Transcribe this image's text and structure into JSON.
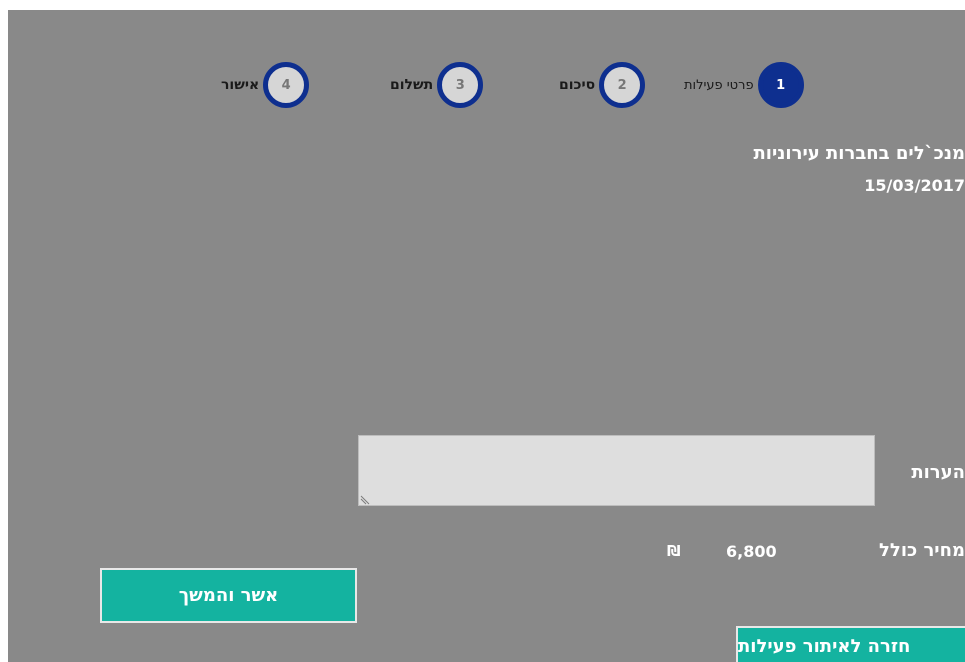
{
  "steps": [
    {
      "number": "1",
      "label": "פרטי פעילות",
      "active": true
    },
    {
      "number": "2",
      "label": "סיכום",
      "active": false
    },
    {
      "number": "3",
      "label": "תשלום",
      "active": false
    },
    {
      "number": "4",
      "label": "אישור",
      "active": false
    }
  ],
  "activity": {
    "title": "מנכ`לים בחברות עירוניות",
    "date": "15/03/2017"
  },
  "notes": {
    "label": "הערות",
    "value": ""
  },
  "price": {
    "label": "מחיר כולל",
    "value": "6,800",
    "currency": "₪"
  },
  "buttons": {
    "confirm_label": "אשר והמשך",
    "back_label": "חזרה לאיתור פעילות"
  },
  "colors": {
    "background": "#898989",
    "step_ring": "#0e2f8f",
    "button": "#14b3a0"
  }
}
